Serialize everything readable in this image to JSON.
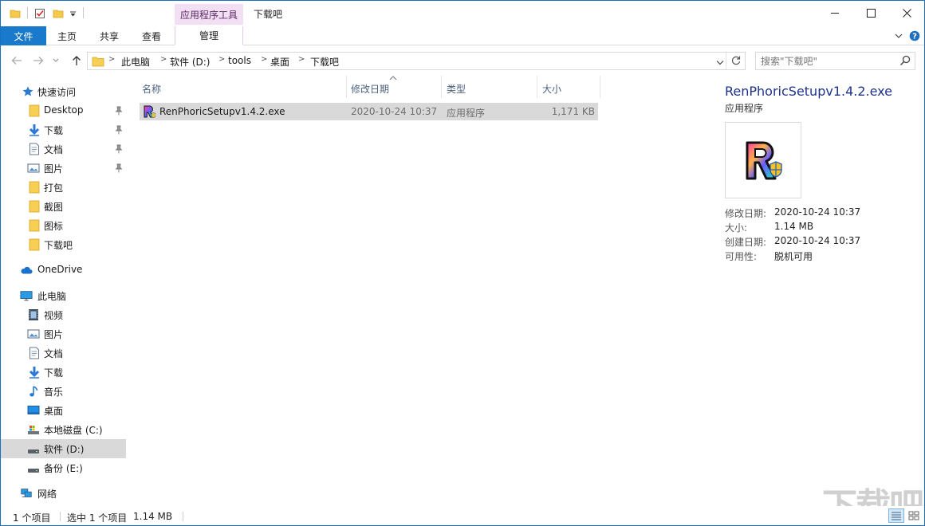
{
  "titlebar": {
    "context_tab": "应用程序工具",
    "window_title": "下载吧",
    "minimize_icon": "minimize-icon",
    "maximize_icon": "maximize-icon",
    "close_icon": "close-icon"
  },
  "ribbon": {
    "tabs": [
      "文件",
      "主页",
      "共享",
      "查看",
      "管理"
    ],
    "accent": "#1979ca"
  },
  "address": {
    "crumbs": [
      "此电脑",
      "软件 (D:)",
      "tools",
      "桌面",
      "下载吧"
    ],
    "search_placeholder": "搜索\"下载吧\""
  },
  "nav": {
    "quick_access": "快速访问",
    "quick_items": [
      "Desktop",
      "下载",
      "文档",
      "图片",
      "打包",
      "截图",
      "图标",
      "下载吧"
    ],
    "onedrive": "OneDrive",
    "this_pc": "此电脑",
    "pc_items": [
      "视频",
      "图片",
      "文档",
      "下载",
      "音乐",
      "桌面",
      "本地磁盘 (C:)",
      "软件 (D:)",
      "备份 (E:)"
    ],
    "network": "网络",
    "selected": "软件 (D:)"
  },
  "columns": {
    "name": "名称",
    "modified": "修改日期",
    "type": "类型",
    "size": "大小"
  },
  "files": [
    {
      "name": "RenPhoricSetupv1.4.2.exe",
      "modified": "2020-10-24 10:37",
      "type": "应用程序",
      "size": "1,171 KB"
    }
  ],
  "preview": {
    "filename": "RenPhoricSetupv1.4.2.exe",
    "filetype": "应用程序",
    "props": [
      {
        "key": "修改日期:",
        "value": "2020-10-24 10:37"
      },
      {
        "key": "大小:",
        "value": "1.14 MB"
      },
      {
        "key": "创建日期:",
        "value": "2020-10-24 10:37"
      },
      {
        "key": "可用性:",
        "value": "脱机可用"
      }
    ]
  },
  "status": {
    "count": "1 个项目",
    "selected": "选中 1 个项目",
    "selected_size": "1.14 MB"
  },
  "watermark": "下载吧"
}
